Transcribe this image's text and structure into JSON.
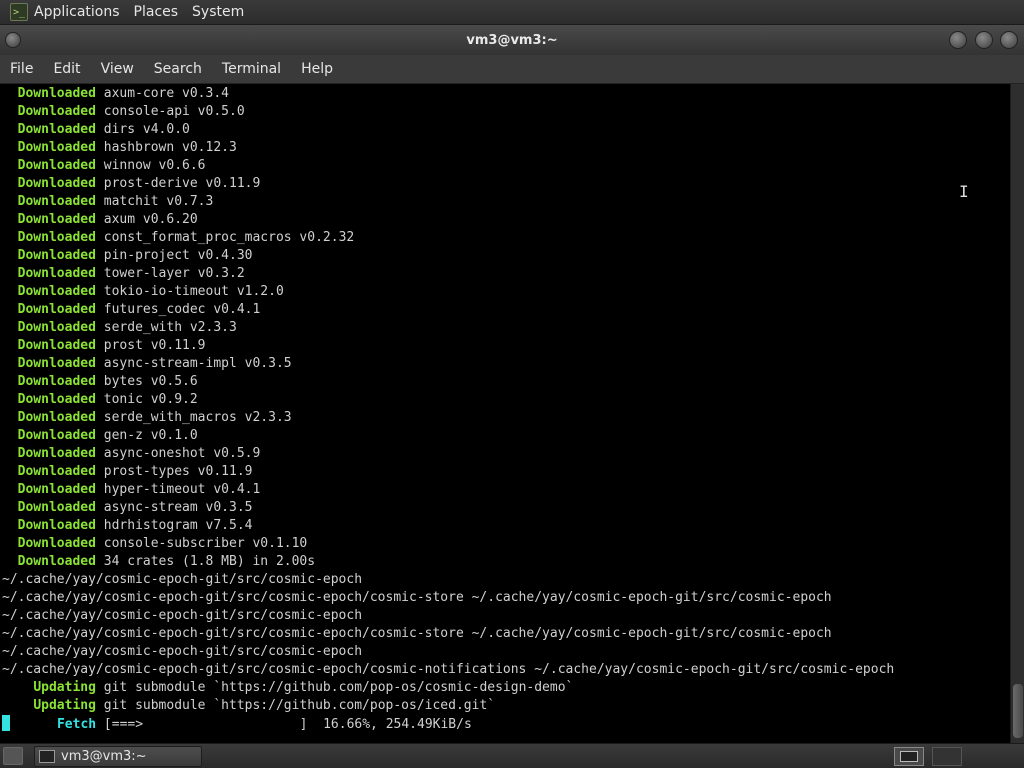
{
  "top_panel": {
    "menus": [
      "Applications",
      "Places",
      "System"
    ]
  },
  "window": {
    "title": "vm3@vm3:~"
  },
  "menubar": {
    "items": [
      "File",
      "Edit",
      "View",
      "Search",
      "Terminal",
      "Help"
    ]
  },
  "terminal": {
    "lines": [
      {
        "kw": "Downloaded",
        "kw_color": "green",
        "indent": "  ",
        "text": " axum-core v0.3.4"
      },
      {
        "kw": "Downloaded",
        "kw_color": "green",
        "indent": "  ",
        "text": " console-api v0.5.0"
      },
      {
        "kw": "Downloaded",
        "kw_color": "green",
        "indent": "  ",
        "text": " dirs v4.0.0"
      },
      {
        "kw": "Downloaded",
        "kw_color": "green",
        "indent": "  ",
        "text": " hashbrown v0.12.3"
      },
      {
        "kw": "Downloaded",
        "kw_color": "green",
        "indent": "  ",
        "text": " winnow v0.6.6"
      },
      {
        "kw": "Downloaded",
        "kw_color": "green",
        "indent": "  ",
        "text": " prost-derive v0.11.9"
      },
      {
        "kw": "Downloaded",
        "kw_color": "green",
        "indent": "  ",
        "text": " matchit v0.7.3"
      },
      {
        "kw": "Downloaded",
        "kw_color": "green",
        "indent": "  ",
        "text": " axum v0.6.20"
      },
      {
        "kw": "Downloaded",
        "kw_color": "green",
        "indent": "  ",
        "text": " const_format_proc_macros v0.2.32"
      },
      {
        "kw": "Downloaded",
        "kw_color": "green",
        "indent": "  ",
        "text": " pin-project v0.4.30"
      },
      {
        "kw": "Downloaded",
        "kw_color": "green",
        "indent": "  ",
        "text": " tower-layer v0.3.2"
      },
      {
        "kw": "Downloaded",
        "kw_color": "green",
        "indent": "  ",
        "text": " tokio-io-timeout v1.2.0"
      },
      {
        "kw": "Downloaded",
        "kw_color": "green",
        "indent": "  ",
        "text": " futures_codec v0.4.1"
      },
      {
        "kw": "Downloaded",
        "kw_color": "green",
        "indent": "  ",
        "text": " serde_with v2.3.3"
      },
      {
        "kw": "Downloaded",
        "kw_color": "green",
        "indent": "  ",
        "text": " prost v0.11.9"
      },
      {
        "kw": "Downloaded",
        "kw_color": "green",
        "indent": "  ",
        "text": " async-stream-impl v0.3.5"
      },
      {
        "kw": "Downloaded",
        "kw_color": "green",
        "indent": "  ",
        "text": " bytes v0.5.6"
      },
      {
        "kw": "Downloaded",
        "kw_color": "green",
        "indent": "  ",
        "text": " tonic v0.9.2"
      },
      {
        "kw": "Downloaded",
        "kw_color": "green",
        "indent": "  ",
        "text": " serde_with_macros v2.3.3"
      },
      {
        "kw": "Downloaded",
        "kw_color": "green",
        "indent": "  ",
        "text": " gen-z v0.1.0"
      },
      {
        "kw": "Downloaded",
        "kw_color": "green",
        "indent": "  ",
        "text": " async-oneshot v0.5.9"
      },
      {
        "kw": "Downloaded",
        "kw_color": "green",
        "indent": "  ",
        "text": " prost-types v0.11.9"
      },
      {
        "kw": "Downloaded",
        "kw_color": "green",
        "indent": "  ",
        "text": " hyper-timeout v0.4.1"
      },
      {
        "kw": "Downloaded",
        "kw_color": "green",
        "indent": "  ",
        "text": " async-stream v0.3.5"
      },
      {
        "kw": "Downloaded",
        "kw_color": "green",
        "indent": "  ",
        "text": " hdrhistogram v7.5.4"
      },
      {
        "kw": "Downloaded",
        "kw_color": "green",
        "indent": "  ",
        "text": " console-subscriber v0.1.10"
      },
      {
        "kw": "Downloaded",
        "kw_color": "green",
        "indent": "  ",
        "text": " 34 crates (1.8 MB) in 2.00s"
      },
      {
        "kw": "",
        "kw_color": "",
        "indent": "",
        "text": "~/.cache/yay/cosmic-epoch-git/src/cosmic-epoch"
      },
      {
        "kw": "",
        "kw_color": "",
        "indent": "",
        "text": "~/.cache/yay/cosmic-epoch-git/src/cosmic-epoch/cosmic-store ~/.cache/yay/cosmic-epoch-git/src/cosmic-epoch"
      },
      {
        "kw": "",
        "kw_color": "",
        "indent": "",
        "text": "~/.cache/yay/cosmic-epoch-git/src/cosmic-epoch"
      },
      {
        "kw": "",
        "kw_color": "",
        "indent": "",
        "text": "~/.cache/yay/cosmic-epoch-git/src/cosmic-epoch/cosmic-store ~/.cache/yay/cosmic-epoch-git/src/cosmic-epoch"
      },
      {
        "kw": "",
        "kw_color": "",
        "indent": "",
        "text": "~/.cache/yay/cosmic-epoch-git/src/cosmic-epoch"
      },
      {
        "kw": "",
        "kw_color": "",
        "indent": "",
        "text": "~/.cache/yay/cosmic-epoch-git/src/cosmic-epoch/cosmic-notifications ~/.cache/yay/cosmic-epoch-git/src/cosmic-epoch"
      },
      {
        "kw": "Updating",
        "kw_color": "green",
        "indent": "    ",
        "text": " git submodule `https://github.com/pop-os/cosmic-design-demo`"
      },
      {
        "kw": "Updating",
        "kw_color": "green",
        "indent": "    ",
        "text": " git submodule `https://github.com/pop-os/iced.git`"
      },
      {
        "kw": "Fetch",
        "kw_color": "cyan",
        "indent": "       ",
        "text": " [===>                    ]  16.66%, 254.49KiB/s",
        "cursor": true
      }
    ]
  },
  "taskbar": {
    "task_label": "vm3@vm3:~"
  },
  "colors": {
    "green": "#8ae234",
    "cyan": "#34e2e2",
    "terminal_bg": "#000000",
    "terminal_fg": "#d0d0d0"
  },
  "icons": {
    "app_menu": "terminal-app-icon",
    "task": "terminal-window-icon",
    "show_desktop": "show-desktop-icon",
    "workspace": "workspace-switcher-icon"
  }
}
